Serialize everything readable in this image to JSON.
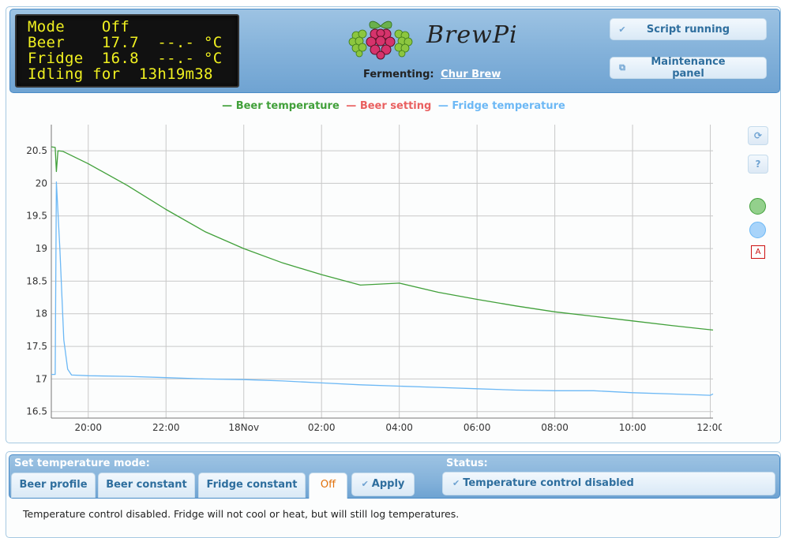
{
  "lcd": {
    "lines": [
      "Mode    Off",
      "Beer    17.7  --.- °C",
      "Fridge  16.8  --.- °C",
      "Idling for  13h19m38"
    ]
  },
  "header": {
    "logo_text": "BrewPi",
    "fermenting_label": "Fermenting:",
    "beer_name": "Chur Brew",
    "script_button": {
      "label": "Script running",
      "icon": "check-icon"
    },
    "maintenance_button": {
      "label": "Maintenance panel",
      "icon": "new-window-icon"
    }
  },
  "side_tools": {
    "refresh_label": "⟳",
    "help_label": "?",
    "annotation_label": "A"
  },
  "colors": {
    "beer_temperature": "#41a03a",
    "beer_setting": "#e96060",
    "fridge_temperature": "#6cb8f5",
    "header_blue": "#84b2da",
    "accent_text": "#2e6e9e",
    "active_mode": "#e17009"
  },
  "chart_data": {
    "type": "line",
    "title": "",
    "xlabel": "",
    "ylabel": "",
    "legend": [
      "Beer temperature",
      "Beer setting",
      "Fridge temperature"
    ],
    "legend_position": "top-center",
    "grid": true,
    "x_unit": "hours since 17 Nov 00:00",
    "xlim": [
      19.05,
      36.07
    ],
    "ylim": [
      16.4,
      20.9
    ],
    "x_ticks": [
      {
        "value": 20,
        "label": "20:00"
      },
      {
        "value": 22,
        "label": "22:00"
      },
      {
        "value": 24,
        "label": "18Nov"
      },
      {
        "value": 26,
        "label": "02:00"
      },
      {
        "value": 28,
        "label": "04:00"
      },
      {
        "value": 30,
        "label": "06:00"
      },
      {
        "value": 32,
        "label": "08:00"
      },
      {
        "value": 34,
        "label": "10:00"
      },
      {
        "value": 36,
        "label": "12:00"
      }
    ],
    "y_ticks": [
      16.5,
      17,
      17.5,
      18,
      18.5,
      19,
      19.5,
      20,
      20.5
    ],
    "series": [
      {
        "name": "Beer temperature",
        "color": "#41a03a",
        "x": [
          19.05,
          19.15,
          19.18,
          19.22,
          19.35,
          20.0,
          21.0,
          22.0,
          23.0,
          24.0,
          25.0,
          26.0,
          27.0,
          28.0,
          29.0,
          30.0,
          31.0,
          32.0,
          33.0,
          34.0,
          35.0,
          36.07
        ],
        "y": [
          20.56,
          20.55,
          20.18,
          20.5,
          20.49,
          20.3,
          19.97,
          19.6,
          19.26,
          19.0,
          18.78,
          18.6,
          18.44,
          18.47,
          18.33,
          18.22,
          18.12,
          18.03,
          17.96,
          17.89,
          17.82,
          17.75
        ]
      },
      {
        "name": "Beer setting",
        "color": "#e96060",
        "x": [],
        "y": []
      },
      {
        "name": "Fridge temperature",
        "color": "#6cb8f5",
        "x": [
          19.05,
          19.15,
          19.18,
          19.27,
          19.37,
          19.47,
          19.57,
          20.0,
          21.0,
          22.0,
          23.0,
          24.0,
          25.0,
          26.0,
          27.0,
          28.0,
          29.0,
          30.0,
          31.0,
          32.0,
          33.0,
          34.0,
          35.0,
          36.0,
          36.07
        ],
        "y": [
          17.07,
          17.07,
          20.02,
          19.0,
          17.6,
          17.15,
          17.06,
          17.05,
          17.04,
          17.02,
          17.0,
          16.99,
          16.97,
          16.94,
          16.91,
          16.89,
          16.87,
          16.85,
          16.83,
          16.82,
          16.82,
          16.79,
          16.77,
          16.75,
          16.77
        ]
      }
    ]
  },
  "mode_panel": {
    "title": "Set temperature mode:",
    "tabs": [
      {
        "label": "Beer profile",
        "active": false
      },
      {
        "label": "Beer constant",
        "active": false
      },
      {
        "label": "Fridge constant",
        "active": false
      },
      {
        "label": "Off",
        "active": true
      }
    ],
    "apply_label": "Apply",
    "description": "Temperature control disabled. Fridge will not cool or heat, but will still log temperatures."
  },
  "status_panel": {
    "title": "Status:",
    "message": "Temperature control disabled"
  }
}
